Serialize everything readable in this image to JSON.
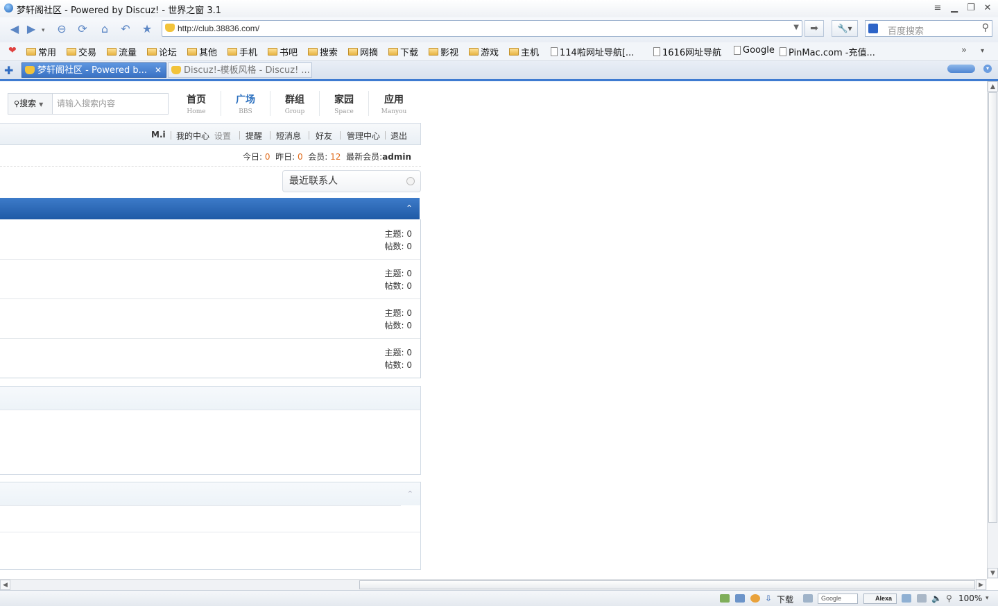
{
  "window": {
    "title": "梦轩阁社区 - Powered by Discuz! - 世界之窗 3.1"
  },
  "addressbar": {
    "url": "http://club.38836.com/",
    "search_placeholder": "百度搜索"
  },
  "bookmarks": [
    {
      "label": "常用",
      "type": "folder"
    },
    {
      "label": "交易",
      "type": "folder"
    },
    {
      "label": "流量",
      "type": "folder"
    },
    {
      "label": "论坛",
      "type": "folder"
    },
    {
      "label": "其他",
      "type": "folder"
    },
    {
      "label": "手机",
      "type": "folder"
    },
    {
      "label": "书吧",
      "type": "folder"
    },
    {
      "label": "搜索",
      "type": "folder"
    },
    {
      "label": "网摘",
      "type": "folder"
    },
    {
      "label": "下载",
      "type": "folder"
    },
    {
      "label": "影视",
      "type": "folder"
    },
    {
      "label": "游戏",
      "type": "folder"
    },
    {
      "label": "主机",
      "type": "folder"
    },
    {
      "label": "114啦网址导航[...",
      "type": "page"
    },
    {
      "label": "1616网址导航",
      "type": "page"
    },
    {
      "label": "Google",
      "type": "page"
    },
    {
      "label": "PinMac.com -充值...",
      "type": "page"
    }
  ],
  "tabs": [
    {
      "label": "梦轩阁社区 - Powered b...",
      "active": true
    },
    {
      "label": "Discuz!-模板风格 - Discuz! ...",
      "active": false
    }
  ],
  "site": {
    "search": {
      "select_label": "搜索",
      "placeholder": "请输入搜索内容"
    },
    "nav": [
      {
        "cn": "首页",
        "en": "Home"
      },
      {
        "cn": "广场",
        "en": "BBS"
      },
      {
        "cn": "群组",
        "en": "Group"
      },
      {
        "cn": "家园",
        "en": "Space"
      },
      {
        "cn": "应用",
        "en": "Manyou"
      }
    ],
    "userbar": {
      "username": "M.i",
      "links": [
        "我的中心",
        "设置",
        "提醒",
        "短消息",
        "好友",
        "管理中心",
        "退出"
      ]
    },
    "stats": {
      "today_label": "今日:",
      "today": "0",
      "yesterday_label": "昨日:",
      "yesterday": "0",
      "members_label": "会员:",
      "members": "12",
      "newest_label": "最新会员:",
      "newest": "admin"
    },
    "recent_contacts": "最近联系人",
    "forums": [
      {
        "topics_label": "主题:",
        "topics": "0",
        "posts_label": "帖数:",
        "posts": "0"
      },
      {
        "topics_label": "主题:",
        "topics": "0",
        "posts_label": "帖数:",
        "posts": "0"
      },
      {
        "topics_label": "主题:",
        "topics": "0",
        "posts_label": "帖数:",
        "posts": "0"
      },
      {
        "topics_label": "主题:",
        "topics": "0",
        "posts_label": "帖数:",
        "posts": "0"
      }
    ]
  },
  "statusbar": {
    "download_label": "下载",
    "google_label": "Google",
    "alexa_label": "Alexa",
    "zoom": "100%"
  },
  "colors": {
    "accent_blue": "#2a6fbf",
    "header_blue": "#1f5aa6",
    "stat_orange": "#e06b1b"
  }
}
